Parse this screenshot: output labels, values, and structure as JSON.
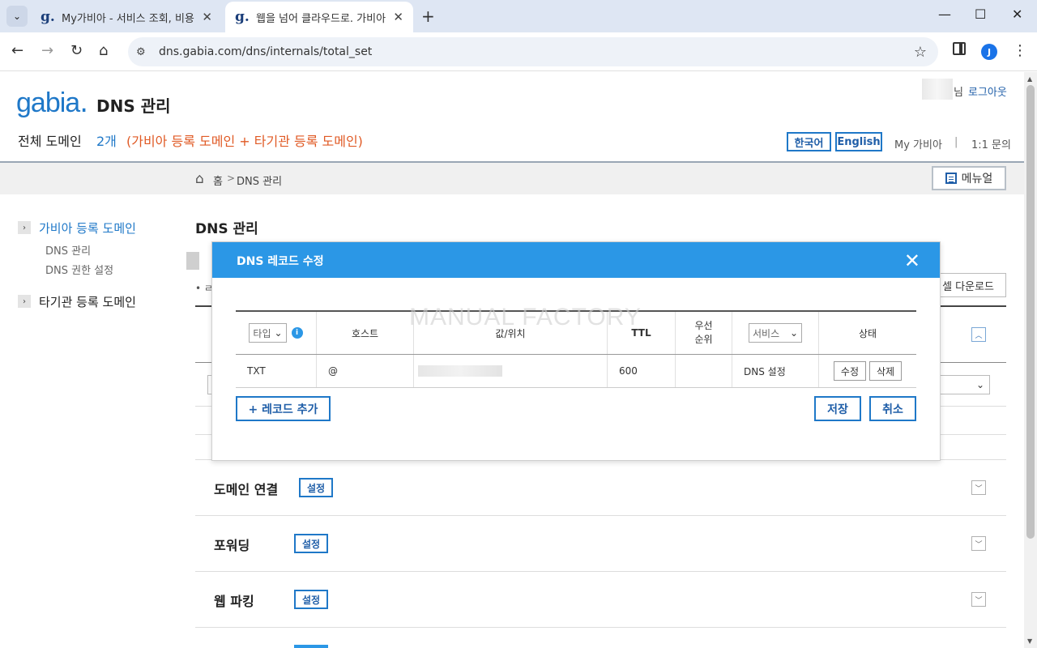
{
  "browser": {
    "tabs": [
      {
        "favicon": "g.",
        "title": "My가비아 - 서비스 조회, 비용"
      },
      {
        "favicon": "g.",
        "title": "웹을 넘어 클라우드로. 가비아"
      }
    ],
    "url": "dns.gabia.com/dns/internals/total_set",
    "profile_initial": "J"
  },
  "header": {
    "logo": "gabia",
    "logo_dot": ".",
    "title": "DNS 관리",
    "user_suffix": "님",
    "logout": "로그아웃",
    "total_label": "전체 도메인",
    "total_count": "2개",
    "total_note": "(가비아 등록 도메인 + 타기관 등록 도메인)",
    "lang_ko": "한국어",
    "lang_en": "English",
    "my_gabia": "My 가비아",
    "divider": "|",
    "inquiry": "1:1 문의"
  },
  "breadcrumb": {
    "home": "홈",
    "sep": ">",
    "current": "DNS 관리",
    "manual": "메뉴얼"
  },
  "sidebar": {
    "arrow": "›",
    "main1": "가비아 등록 도메인",
    "sub1": "DNS 관리",
    "sub2": "DNS 권한 설정",
    "main2": "타기관 등록 도메인"
  },
  "content": {
    "title": "DNS 관리",
    "excel": "셀 다운로드",
    "bullet_fragment": "• ㄹ",
    "sections": [
      {
        "title": "도메인 연결",
        "button": "설정"
      },
      {
        "title": "포워딩",
        "button": "설정"
      },
      {
        "title": "웹 파킹",
        "button": "설정"
      }
    ]
  },
  "modal": {
    "title": "DNS 레코드 수정",
    "watermark": "MANUAL FACTORY",
    "columns": {
      "type_select": "타입",
      "host": "호스트",
      "value": "값/위치",
      "ttl": "TTL",
      "priority_1": "우선",
      "priority_2": "순위",
      "service_select": "서비스",
      "status": "상태"
    },
    "rows": [
      {
        "type": "TXT",
        "host": "@",
        "ttl": "600",
        "priority": "",
        "service": "DNS 설정",
        "edit": "수정",
        "delete": "삭제"
      }
    ],
    "add_record": "+ 레코드 추가",
    "save": "저장",
    "cancel": "취소"
  },
  "colors": {
    "accent": "#2b97e6",
    "brand": "#1f78c8",
    "note": "#e05a25"
  }
}
